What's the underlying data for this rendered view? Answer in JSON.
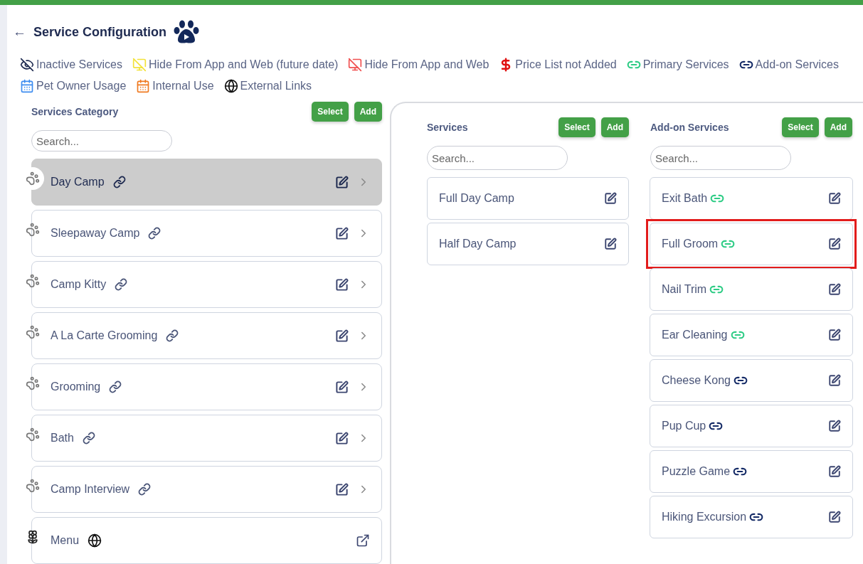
{
  "header": {
    "back": "←",
    "title": "Service Configuration"
  },
  "legend_rows": [
    {
      "items": [
        {
          "kind": "inactive",
          "label": "Inactive Services"
        },
        {
          "kind": "hide-future",
          "label": "Hide From App and Web (future date)"
        },
        {
          "kind": "hide",
          "label": "Hide From App and Web"
        },
        {
          "kind": "no-price",
          "label": "Price List not Added"
        },
        {
          "kind": "primary",
          "label": "Primary Services"
        },
        {
          "kind": "addon",
          "label": "Add-on Services"
        }
      ]
    },
    {
      "items": [
        {
          "kind": "pet-owner",
          "label": "Pet Owner Usage"
        },
        {
          "kind": "internal",
          "label": "Internal Use"
        },
        {
          "kind": "external",
          "label": "External Links"
        }
      ]
    }
  ],
  "categories": {
    "title": "Services Category",
    "buttons": [
      "Select",
      "Add"
    ],
    "search": {
      "placeholder": "Search..."
    },
    "items": [
      {
        "name": "Day Camp",
        "kind": "service",
        "selected": true
      },
      {
        "name": "Sleepaway Camp",
        "kind": "service",
        "selected": false
      },
      {
        "name": "Camp Kitty",
        "kind": "service",
        "selected": false
      },
      {
        "name": "A La Carte Grooming",
        "kind": "service",
        "selected": false
      },
      {
        "name": "Grooming",
        "kind": "service",
        "selected": false
      },
      {
        "name": "Bath",
        "kind": "service",
        "selected": false
      },
      {
        "name": "Camp Interview",
        "kind": "service",
        "selected": false
      },
      {
        "name": "Menu",
        "kind": "external",
        "selected": false
      }
    ]
  },
  "services": {
    "title": "Services",
    "buttons": [
      "Select",
      "Add"
    ],
    "search": {
      "placeholder": "Search..."
    },
    "items": [
      {
        "name": "Full Day Camp"
      },
      {
        "name": "Half Day Camp"
      }
    ]
  },
  "addons": {
    "title": "Add-on Services",
    "buttons": [
      "Select",
      "Add"
    ],
    "search": {
      "placeholder": "Search..."
    },
    "items": [
      {
        "name": "Exit Bath",
        "kind": "primary",
        "highlighted": false
      },
      {
        "name": "Full Groom",
        "kind": "primary",
        "highlighted": true
      },
      {
        "name": "Nail Trim",
        "kind": "primary",
        "highlighted": false
      },
      {
        "name": "Ear Cleaning",
        "kind": "primary",
        "highlighted": false
      },
      {
        "name": "Cheese Kong",
        "kind": "addon",
        "highlighted": false
      },
      {
        "name": "Pup Cup",
        "kind": "addon",
        "highlighted": false
      },
      {
        "name": "Puzzle Game",
        "kind": "addon",
        "highlighted": false
      },
      {
        "name": "Hiking Excursion",
        "kind": "addon",
        "highlighted": false
      }
    ]
  }
}
